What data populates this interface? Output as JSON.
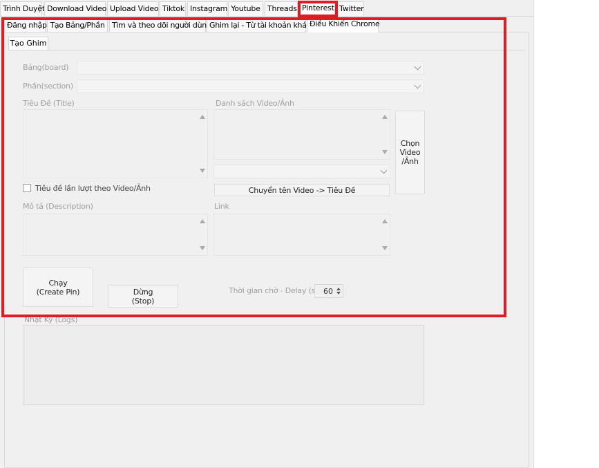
{
  "top_tabs": [
    "Trình Duyệt",
    "Download Video",
    "Upload Video",
    "Tiktok",
    "Instagram",
    "Youtube",
    "Threads",
    "Pinterest",
    "Twitter"
  ],
  "sub_tabs": [
    "Đăng nhập",
    "Tạo Bảng/Phần",
    "Tìm và theo dõi người dùng",
    "Ghim lại - Từ tài khoản khác",
    "Điều Khiển Chrome"
  ],
  "inner_tab": "Tạo Ghim",
  "form": {
    "board_label": "Bảng(board)",
    "section_label": "Phần(section)",
    "title_label": "Tiêu Đề (Title)",
    "media_list_label": "Danh sách Video/Ảnh",
    "choose_media_button": "Chọn Video /Ảnh",
    "title_per_media_checkbox": "Tiêu đề lần lượt theo Video/Ảnh",
    "convert_name_button": "Chuyển tên Video -> Tiêu Đề",
    "description_label": "Mô tả (Description)",
    "link_label": "Link",
    "run_button_line1": "Chạy",
    "run_button_line2": "(Create Pin)",
    "stop_button_line1": "Dừng",
    "stop_button_line2": "(Stop)",
    "delay_label": "Thời gian chờ - Delay (s)",
    "delay_value": "60"
  },
  "logs_label": "Nhật Ký (Logs)",
  "colors": {
    "highlight": "#e01b24"
  }
}
